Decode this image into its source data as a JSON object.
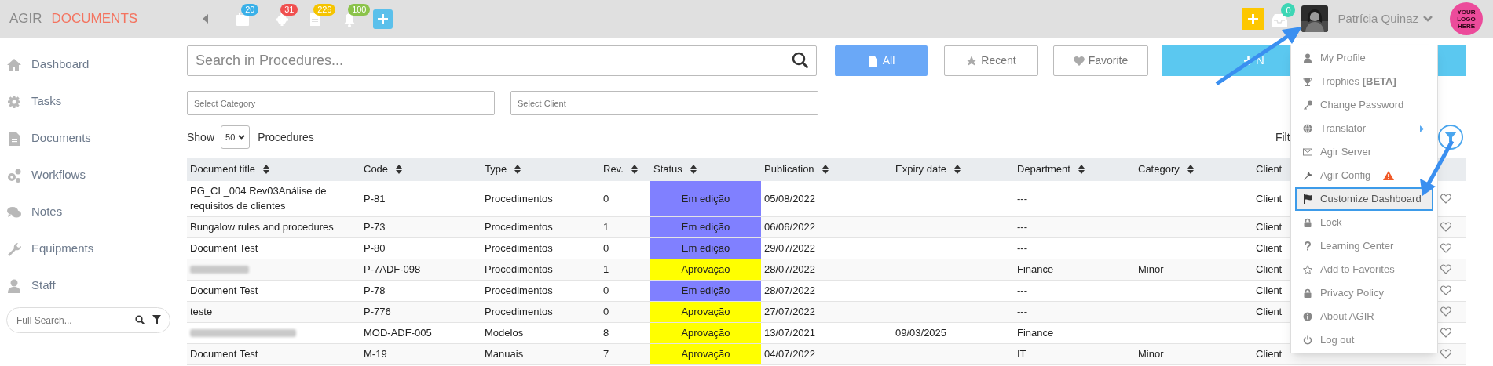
{
  "topbar": {
    "brand": "AGIR",
    "module": "DOCUMENTS",
    "icons": [
      {
        "badge": "20",
        "color": "#3ab0e8"
      },
      {
        "badge": "31",
        "color": "#f0504f"
      },
      {
        "badge": "226",
        "color": "#f5c400"
      },
      {
        "badge": "100",
        "color": "#8bc34a"
      }
    ],
    "inbox_badge": "0",
    "user_name": "Patrícia Quinaz",
    "logo_text": [
      "YOUR",
      "LOGO",
      "HERE"
    ]
  },
  "sidebar": {
    "items": [
      "Dashboard",
      "Tasks",
      "Documents",
      "Workflows",
      "Notes",
      "Equipments",
      "Staff"
    ],
    "search": {
      "placeholder": "Full Search..."
    }
  },
  "search": {
    "placeholder": "Search in Procedures..."
  },
  "filters": [
    {
      "label": "All",
      "selected": true
    },
    {
      "label": "Recent",
      "selected": false
    },
    {
      "label": "Favorite",
      "selected": false
    }
  ],
  "new_button": "N",
  "selects": [
    {
      "placeholder": "Select Category"
    },
    {
      "placeholder": "Select Client"
    }
  ],
  "show": {
    "label": "Show",
    "value": "50",
    "suffix": "Procedures"
  },
  "filter_label": "Filt",
  "table": {
    "columns": [
      "Document title",
      "Code",
      "Type",
      "Rev.",
      "Status",
      "Publication",
      "Expiry date",
      "Department",
      "Category",
      "Client"
    ],
    "rows": [
      {
        "title": "PG_CL_004 Rev03Análise de requisitos de clientes",
        "code": "P-81",
        "type": "Procedimentos",
        "rev": "0",
        "status": "Em edição",
        "color": "#8080ff",
        "publication": "05/08/2022",
        "expiry": "",
        "department": "---",
        "category": "",
        "client": "Client"
      },
      {
        "title": "Bungalow rules and procedures",
        "code": "P-73",
        "type": "Procedimentos",
        "rev": "1",
        "status": "Em edição",
        "color": "#8080ff",
        "publication": "06/06/2022",
        "expiry": "",
        "department": "---",
        "category": "",
        "client": "Client"
      },
      {
        "title": "Document Test",
        "code": "P-80",
        "type": "Procedimentos",
        "rev": "0",
        "status": "Em edição",
        "color": "#8080ff",
        "publication": "29/07/2022",
        "expiry": "",
        "department": "---",
        "category": "",
        "client": "Client"
      },
      {
        "title_redacted": true,
        "code": "P-7ADF-098",
        "type": "Procedimentos",
        "rev": "1",
        "status": "Aprovação",
        "color": "#ffff00",
        "publication": "28/07/2022",
        "expiry": "",
        "department": "Finance",
        "category": "Minor",
        "client": "Client"
      },
      {
        "title": "Document Test",
        "code": "P-78",
        "type": "Procedimentos",
        "rev": "0",
        "status": "Em edição",
        "color": "#8080ff",
        "publication": "28/07/2022",
        "expiry": "",
        "department": "---",
        "category": "",
        "client": "Client"
      },
      {
        "title": "teste",
        "code": "P-776",
        "type": "Procedimentos",
        "rev": "0",
        "status": "Aprovação",
        "color": "#ffff00",
        "publication": "27/07/2022",
        "expiry": "",
        "department": "---",
        "category": "",
        "client": "Client"
      },
      {
        "title_redacted": true,
        "code": "MOD-ADF-005",
        "type": "Modelos",
        "rev": "8",
        "status": "Aprovação",
        "color": "#ffff00",
        "publication": "13/07/2021",
        "expiry": "09/03/2025",
        "department": "Finance",
        "category": "",
        "client": ""
      },
      {
        "title": "Document Test",
        "code": "M-19",
        "type": "Manuais",
        "rev": "7",
        "status": "Aprovação",
        "color": "#ffff00",
        "publication": "04/07/2022",
        "expiry": "",
        "department": "IT",
        "category": "Minor",
        "client": "Client"
      }
    ]
  },
  "user_menu": {
    "items": [
      {
        "label": "My Profile",
        "selected": false
      },
      {
        "label": "Trophies **[BETA]**",
        "selected": false
      },
      {
        "label": "Change Password",
        "selected": false
      },
      {
        "label": "Translator",
        "selected": false,
        "submenu": true
      },
      {
        "label": "Agir Server",
        "selected": false
      },
      {
        "label": "Agir Config",
        "selected": false,
        "warning": true
      },
      {
        "label": "Customize Dashboard",
        "selected": true
      },
      {
        "label": "Lock",
        "selected": false
      },
      {
        "label": "Learning Center",
        "selected": false
      },
      {
        "label": "Add to Favorites",
        "selected": false
      },
      {
        "label": "Privacy Policy",
        "selected": false
      },
      {
        "label": "About AGIR",
        "selected": false
      },
      {
        "label": "Log out",
        "selected": false
      }
    ]
  }
}
